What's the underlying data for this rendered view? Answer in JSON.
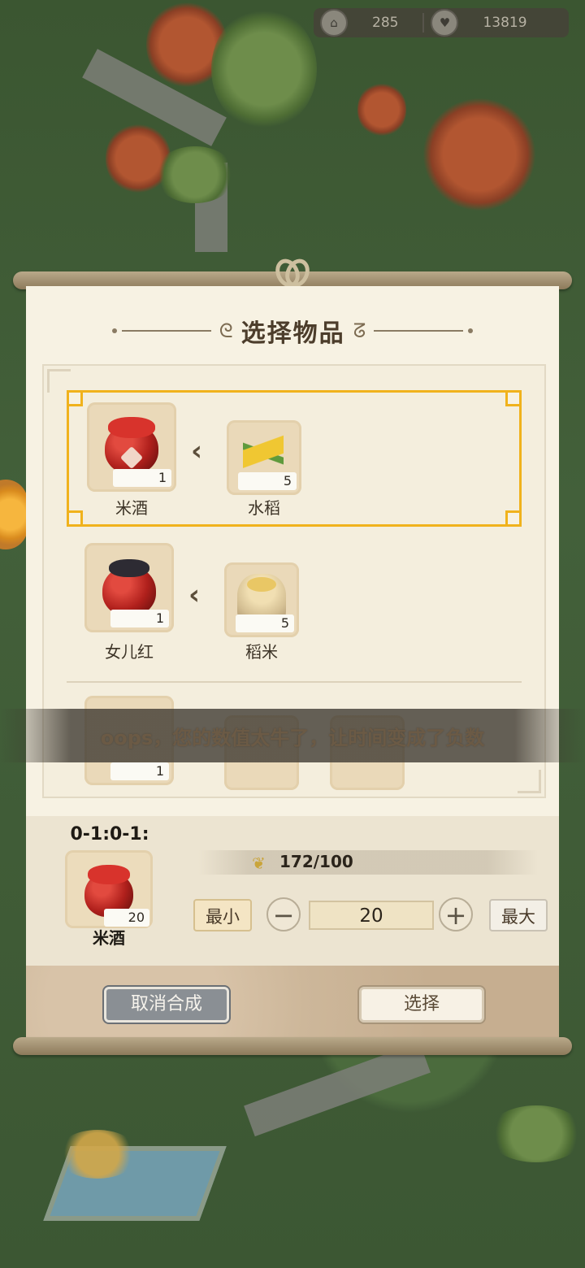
{
  "resources": {
    "house_value": "285",
    "heart_value": "13819"
  },
  "dialog": {
    "title": "选择物品",
    "recipes": [
      {
        "product": "米酒",
        "product_count": "1",
        "ingredient": "水稻",
        "ingredient_count": "5",
        "selected": true
      },
      {
        "product": "女儿红",
        "product_count": "1",
        "ingredient": "稻米",
        "ingredient_count": "5",
        "selected": false
      },
      {
        "product_count": "1"
      }
    ],
    "toast": "oops，您的数值太牛了，让时间变成了负数",
    "detail": {
      "timer": "0-1:0-1:00",
      "item_name": "米酒",
      "item_count": "20",
      "resource": "172/100",
      "min_label": "最小",
      "max_label": "最大",
      "minus": "−",
      "plus": "+",
      "quantity": "20"
    },
    "buttons": {
      "cancel": "取消合成",
      "select": "选择"
    }
  },
  "colors": {
    "highlight": "#f0b21c",
    "panel": "#f7f2e3",
    "cancel_button": "#8a8f94"
  }
}
